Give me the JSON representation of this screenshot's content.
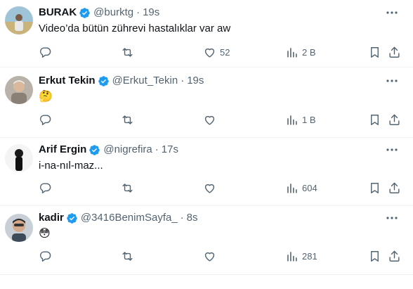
{
  "colors": {
    "text": "#0f1419",
    "secondary": "#536471",
    "verified": "#1d9bf0",
    "divider": "#eff3f4"
  },
  "icons": {
    "verified": "verified-badge-icon",
    "more": "more-horizontal-icon",
    "reply": "reply-icon",
    "retweet": "retweet-icon",
    "like": "heart-icon",
    "views": "analytics-icon",
    "bookmark": "bookmark-icon",
    "share": "share-icon"
  },
  "tweets": [
    {
      "name": "BURAK",
      "handle": "@burktg",
      "separator": "·",
      "time": "19s",
      "text": "Video’da bütün zührevi hastalıklar var aw",
      "likes": "52",
      "views": "2 B"
    },
    {
      "name": "Erkut Tekin",
      "handle": "@Erkut_Tekin",
      "separator": "·",
      "time": "19s",
      "text": "🤔",
      "likes": "",
      "views": "1 B"
    },
    {
      "name": "Arif Ergin",
      "handle": "@nigrefira",
      "separator": "·",
      "time": "17s",
      "text": "i-na-nıl-maz...",
      "likes": "",
      "views": "604"
    },
    {
      "name": "kadir",
      "handle": "@3416BenimSayfa_",
      "separator": "·",
      "time": "8s",
      "text": "😳",
      "likes": "",
      "views": "281"
    }
  ]
}
